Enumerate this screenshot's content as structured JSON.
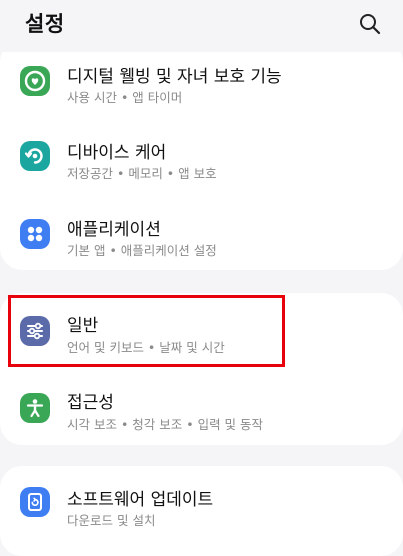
{
  "header": {
    "title": "설정",
    "search_icon": "search-icon"
  },
  "items": [
    {
      "title": "디지털 웰빙 및 자녀 보호 기능",
      "subtitle": "사용 시간 • 앱 타이머",
      "icon": "digital-wellbeing-icon",
      "color": "#3aa757"
    },
    {
      "title": "디바이스 케어",
      "subtitle": "저장공간 • 메모리 • 앱 보호",
      "icon": "device-care-icon",
      "color": "#1ba7a0"
    },
    {
      "title": "애플리케이션",
      "subtitle": "기본 앱 • 애플리케이션 설정",
      "icon": "apps-icon",
      "color": "#3e7ef2"
    },
    {
      "title": "일반",
      "subtitle": "언어 및 키보드 • 날짜 및 시간",
      "icon": "general-management-icon",
      "color": "#5b6aa8"
    },
    {
      "title": "접근성",
      "subtitle": "시각 보조 • 청각 보조 • 입력 및 동작",
      "icon": "accessibility-icon",
      "color": "#3aa757"
    },
    {
      "title": "소프트웨어 업데이트",
      "subtitle": "다운로드 및 설치",
      "icon": "software-update-icon",
      "color": "#3e7ef2"
    }
  ],
  "highlight_color": "#e8000a"
}
